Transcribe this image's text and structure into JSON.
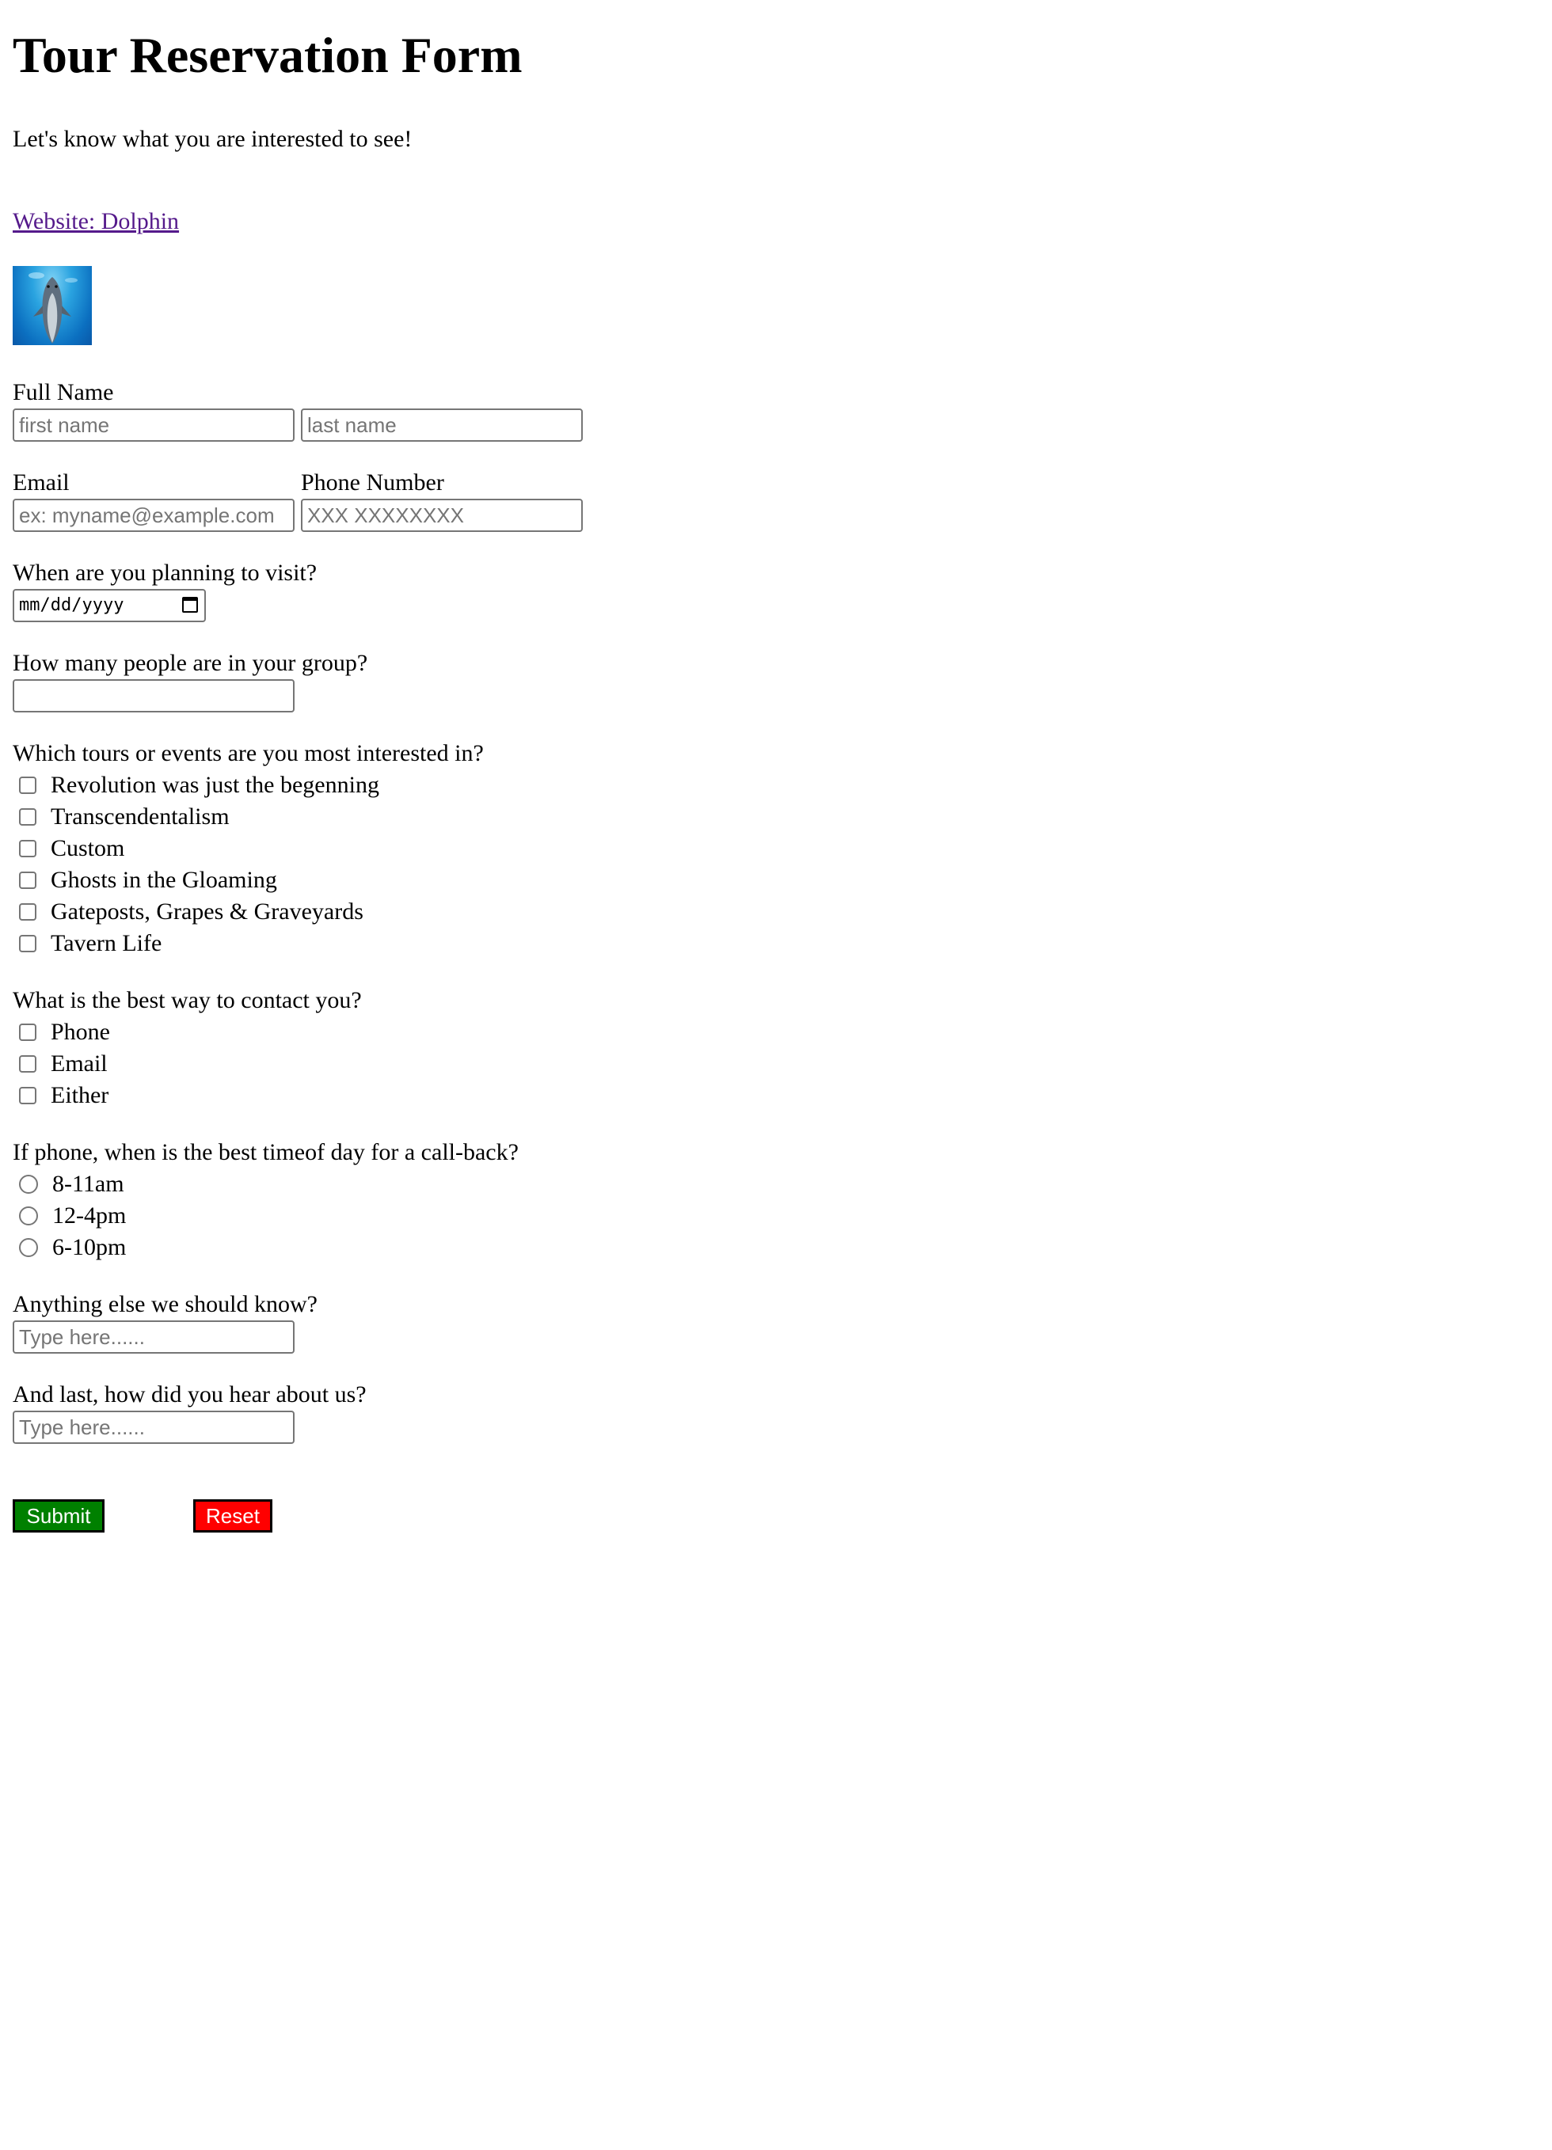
{
  "header": {
    "title": "Tour Reservation Form",
    "tagline": "Let's know what you are interested to see!",
    "website_link": "Website: Dolphin"
  },
  "image": {
    "icon": "dolphin-photo"
  },
  "full_name": {
    "label": "Full Name",
    "first_placeholder": "first name",
    "last_placeholder": "last name"
  },
  "contact_fields": {
    "email_label": "Email",
    "email_placeholder": "ex: myname@example.com",
    "phone_label": "Phone Number",
    "phone_placeholder": "XXX XXXXXXXX"
  },
  "visit": {
    "label": "When are you planning to visit?",
    "date_placeholder": "mm/dd/yyyy",
    "icon": "calendar-icon"
  },
  "group": {
    "label": "How many people are in your group?",
    "value": ""
  },
  "tours": {
    "label": "Which tours or events are you most interested in?",
    "options": [
      "Revolution was just the begenning",
      "Transcendentalism",
      "Custom",
      "Ghosts in the Gloaming",
      "Gateposts, Grapes & Graveyards",
      "Tavern Life"
    ]
  },
  "contact_method": {
    "label": "What is the best way to contact you?",
    "options": [
      "Phone",
      "Email",
      "Either"
    ]
  },
  "callback": {
    "label": "If phone, when is the best timeof day for a call-back?",
    "options": [
      "8-11am",
      "12-4pm",
      "6-10pm"
    ]
  },
  "notes": {
    "label": "Anything else we should know?",
    "placeholder": "Type here......"
  },
  "referral": {
    "label": "And last, how did you hear about us?",
    "placeholder": "Type here......"
  },
  "buttons": {
    "submit": "Submit",
    "reset": "Reset",
    "submit_color": "#008000",
    "reset_color": "#ff0000"
  },
  "colors": {
    "link": "#551a8b"
  }
}
